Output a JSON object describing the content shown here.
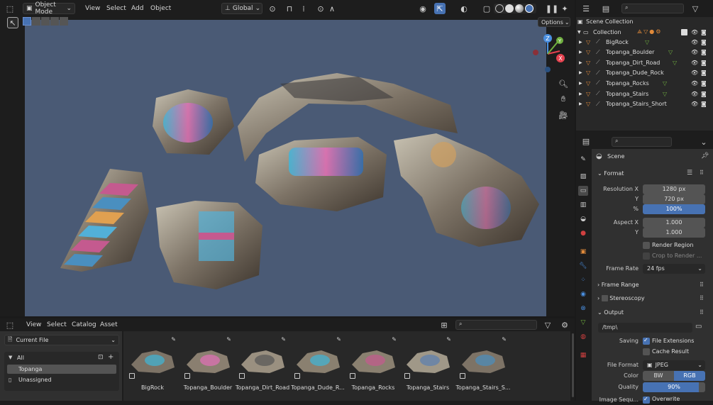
{
  "viewport_header": {
    "mode": "Object Mode",
    "menus": [
      "View",
      "Select",
      "Add",
      "Object"
    ],
    "transform": "Global",
    "options": "Options"
  },
  "outliner": {
    "root": "Scene Collection",
    "collection": "Collection",
    "items": [
      "BigRock",
      "Topanga_Boulder",
      "Topanga_Dirt_Road",
      "Topanga_Dude_Rock",
      "Topanga_Rocks",
      "Topanga_Stairs",
      "Topanga_Stairs_Short"
    ]
  },
  "properties": {
    "scene_label": "Scene",
    "format": {
      "title": "Format",
      "res_x_label": "Resolution X",
      "res_x": "1280 px",
      "res_y_label": "Y",
      "res_y": "720 px",
      "res_pct_label": "%",
      "res_pct": "100%",
      "aspect_x_label": "Aspect X",
      "aspect_x": "1.000",
      "aspect_y_label": "Y",
      "aspect_y": "1.000",
      "render_region": "Render Region",
      "crop": "Crop to Render ...",
      "frame_rate_label": "Frame Rate",
      "frame_rate": "24 fps"
    },
    "frame_range": "Frame Range",
    "stereoscopy": "Stereoscopy",
    "output": {
      "title": "Output",
      "path": "/tmp\\",
      "saving_label": "Saving",
      "file_extensions": "File Extensions",
      "cache_result": "Cache Result",
      "file_format_label": "File Format",
      "file_format": "JPEG",
      "color_label": "Color",
      "color_bw": "BW",
      "color_rgb": "RGB",
      "quality_label": "Quality",
      "quality": "90%",
      "quality_value": 0.9,
      "image_seq_label": "Image Sequ...",
      "overwrite": "Overwrite"
    }
  },
  "asset_browser": {
    "menus": [
      "View",
      "Select",
      "Catalog",
      "Asset"
    ],
    "library": "Current File",
    "tree": {
      "all": "All",
      "topanga": "Topanga",
      "unassigned": "Unassigned"
    },
    "assets": [
      "BigRock",
      "Topanga_Boulder",
      "Topanga_Dirt_Road",
      "Topanga_Dude_R...",
      "Topanga_Rocks",
      "Topanga_Stairs",
      "Topanga_Stairs_S..."
    ]
  },
  "gizmo": {
    "x": "X",
    "y": "Y",
    "z": "Z"
  },
  "colors": {
    "viewport_bg": "#4a5a75",
    "accent": "#4772b3",
    "panel": "#303030"
  }
}
